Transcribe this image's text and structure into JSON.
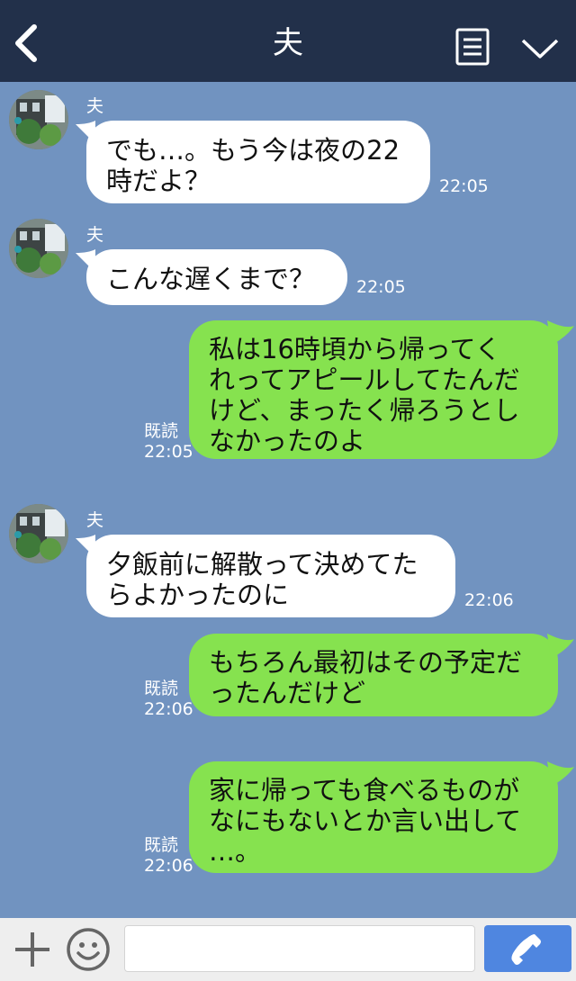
{
  "header": {
    "title": "夫",
    "back_icon": "chevron-left-icon",
    "menu_icon": "menu-list-icon",
    "collapse_icon": "chevron-down-icon"
  },
  "messages": [
    {
      "direction": "in",
      "sender": "夫",
      "text": "でも…。もう今は夜の22\n時だよ？",
      "time": "22:05"
    },
    {
      "direction": "in",
      "sender": "夫",
      "text": "こんな遅くまで？",
      "time": "22:05"
    },
    {
      "direction": "out",
      "read": "既読",
      "text": "私は16時頃から帰ってく\nれってアピールしてたんだ\nけど、まったく帰ろうとし\nなかったのよ",
      "time": "22:05"
    },
    {
      "direction": "in",
      "sender": "夫",
      "text": "夕飯前に解散って決めてた\nらよかったのに",
      "time": "22:06"
    },
    {
      "direction": "out",
      "read": "既読",
      "text": "もちろん最初はその予定だ\nったんだけど",
      "time": "22:06"
    },
    {
      "direction": "out",
      "read": "既読",
      "text": "家に帰っても食べるものが\nなにもないとか言い出して\n…。",
      "time": "22:06"
    }
  ],
  "footer": {
    "add_icon": "plus-icon",
    "emoji_icon": "smiley-icon",
    "input_value": "",
    "call_icon": "phone-icon"
  },
  "colors": {
    "header_bg": "#22304a",
    "chat_bg": "#7193c0",
    "incoming_bubble": "#ffffff",
    "outgoing_bubble": "#86e24f",
    "call_button": "#4f86e0"
  }
}
